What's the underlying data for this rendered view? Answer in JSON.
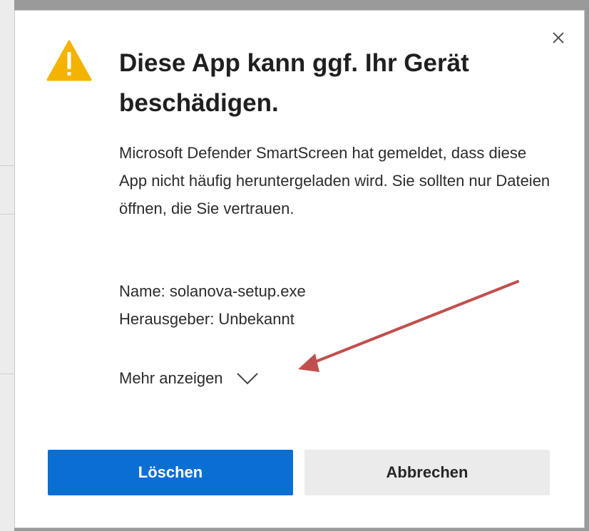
{
  "dialog": {
    "title": "Diese App kann ggf. Ihr Gerät beschädigen.",
    "message": "Microsoft Defender SmartScreen hat gemeldet, dass diese App nicht häufig heruntergeladen wird. Sie sollten nur Dateien öffnen, die Sie vertrauen.",
    "file_name": "Name: solanova-setup.exe",
    "publisher": "Herausgeber: Unbekannt",
    "more_label": "Mehr anzeigen",
    "delete_label": "Löschen",
    "cancel_label": "Abbrechen",
    "icons": {
      "warning": "warning-icon",
      "close": "close-icon",
      "chevron": "chevron-down-icon"
    }
  },
  "colors": {
    "primary_button": "#0a6fd3",
    "secondary_button": "#ebebeb",
    "warning_icon": "#f5b301",
    "annotation_arrow": "#c0504d"
  }
}
